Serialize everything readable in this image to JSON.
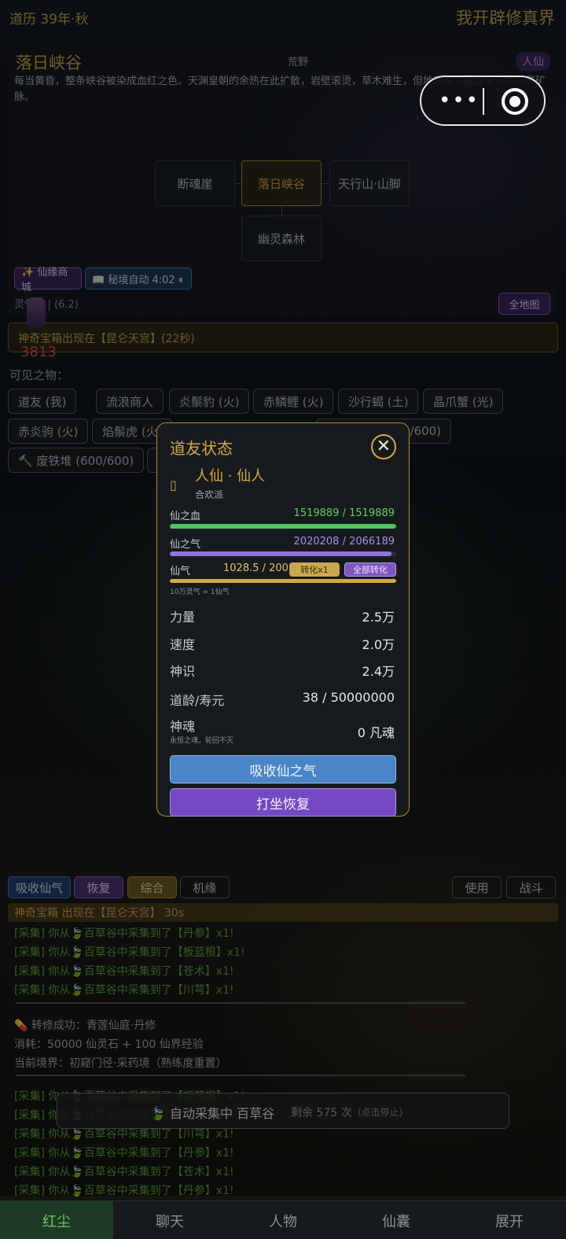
{
  "top": {
    "era": "道历 39年·秋",
    "app_title": "我开辟修真界"
  },
  "location": {
    "name": "落日峡谷",
    "type": "荒野",
    "realm": "人仙",
    "description": "每当黄昏，整条峡谷被染成血红之色。天渊皇朝的余热在此扩散，岩壁滚烫，草木难生，但地底深处蕴含罕见的火灵矿脉。",
    "nodes": {
      "north": "断魂崖",
      "current": "落日峡谷",
      "east": "天行山·山脚",
      "south": "幽灵森林"
    },
    "shop_label": "✨ 仙缘商城",
    "secret_label": "📖 秘境自动 4:02 ⏸",
    "spirit_text": "灵气 0  |  (6.2)",
    "map_label": "全地图"
  },
  "banner": "神奇宝箱出现在【昆仑天宫】(22秒)",
  "power": "3813",
  "visible": {
    "label": "可见之物：",
    "row1": [
      "道友 (我)",
      "流浪商人",
      "炎鬃豹 (火)",
      "赤鳞鲤 (火)",
      "沙行蝎 (土)",
      "晶爪蟹 (光)"
    ],
    "row2": [
      "赤炎驹 (火)",
      "焰鬃虎 (火)",
      "/600)"
    ],
    "row3": [
      "🔨 废铁堆 (600/600)"
    ]
  },
  "modal": {
    "title": "道友状态",
    "close": "✕",
    "rank": "人仙 · 仙人",
    "sect": "合欢派",
    "blood": {
      "label": "仙之血",
      "text": "1519889 / 1519889",
      "fill": 1.0
    },
    "qi": {
      "label": "仙之气",
      "text": "2020208 / 2066189",
      "fill": 0.978
    },
    "xianqi": {
      "label": "仙气",
      "text": "1028.5 / 200",
      "fill": 1.0,
      "btn1": "转化x1",
      "btn2": "全部转化"
    },
    "note": "10万灵气 = 1仙气",
    "stats": [
      {
        "label": "力量",
        "value": "2.5万"
      },
      {
        "label": "速度",
        "value": "2.0万"
      },
      {
        "label": "神识",
        "value": "2.4万"
      },
      {
        "label": "道龄/寿元",
        "value": "38 / 50000000"
      }
    ],
    "soul": {
      "label": "神魂",
      "sub": "永恒之魂，轮回不灭",
      "value": "0  凡魂"
    },
    "btn_absorb": "吸收仙之气",
    "btn_meditate": "打坐恢复"
  },
  "bottom_tabs": {
    "absorb": "吸收仙气",
    "recover": "恢复",
    "all": "综合",
    "chance": "机缘",
    "use": "使用",
    "fight": "战斗"
  },
  "bottom_banner": "神奇宝箱 出现在【昆仑天宫】 30s",
  "logs_a": [
    "[采集] 你从🍃百草谷中采集到了【丹参】x1!",
    "[采集] 你从🍃百草谷中采集到了【板蓝根】x1!",
    "[采集] 你从🍃百草谷中采集到了【苍术】x1!",
    "[采集] 你从🍃百草谷中采集到了【川芎】x1!"
  ],
  "switch": {
    "line1": "💊 转修成功：青莲仙庭·丹修",
    "line2": "消耗：50000 仙灵石 + 100 仙界经验",
    "line3": "当前境界：初窥门径·采药境（熟练度重置）"
  },
  "logs_b": [
    "[采集] 你从🍃百草谷中采集到了【板蓝根】x1!",
    "[采集] 你从🍃百草谷中采集到了【川芎】x1!",
    "[采集] 你从🍃百草谷中采集到了【川芎】x1!",
    "[采集] 你从🍃百草谷中采集到了【丹参】x1!",
    "[采集] 你从🍃百草谷中采集到了【苍术】x1!",
    "[采集] 你从🍃百草谷中采集到了【丹参】x1!"
  ],
  "auto": {
    "text": "🍃 自动采集中 百草谷",
    "remain": "剩余 575 次",
    "hint": "(点击停止)"
  },
  "nav": [
    "红尘",
    "聊天",
    "人物",
    "仙囊",
    "展开"
  ]
}
